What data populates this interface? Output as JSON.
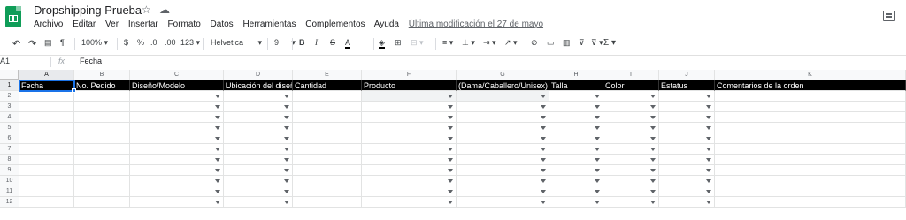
{
  "app": {
    "doc_title": "Dropshipping Prueba",
    "title_icons": [
      "star-icon",
      "cloud-icon"
    ]
  },
  "menu": {
    "items": [
      "Archivo",
      "Editar",
      "Ver",
      "Insertar",
      "Formato",
      "Datos",
      "Herramientas",
      "Complementos",
      "Ayuda"
    ],
    "last_edit": "Última modificación el 27 de mayo"
  },
  "toolbar": {
    "zoom": "100%",
    "currency": "$",
    "percent": "%",
    "dec_less": ".0",
    "dec_more": ".00",
    "format": "123",
    "font": "Helvetica",
    "font_size": "9",
    "bold": "B",
    "italic": "I",
    "strike": "S",
    "underline": "A",
    "sigma": "Σ"
  },
  "formula_bar": {
    "cell_ref": "A1",
    "fx": "fx",
    "value": "Fecha"
  },
  "sheet": {
    "columns": [
      "A",
      "B",
      "C",
      "D",
      "E",
      "F",
      "G",
      "H",
      "I",
      "J",
      "K"
    ],
    "headers": [
      "Fecha",
      "No. Pedido",
      "Diseño/Modelo",
      "Ubicación del diseño",
      "Cantidad",
      "Producto",
      "(Dama/Caballero/Unisex)",
      "Talla",
      "Color",
      "Estatus",
      "Comentarios de la orden"
    ],
    "row_numbers": [
      "1",
      "2",
      "3",
      "4",
      "5",
      "6",
      "7",
      "8",
      "9",
      "10",
      "11",
      "12"
    ],
    "dropdown_columns": [
      "C",
      "D",
      "F",
      "G",
      "H",
      "I",
      "J"
    ],
    "highlighted_cells": [
      "F2",
      "G2"
    ],
    "selected_cell": "A1"
  },
  "colors": {
    "header_bg": "#000000",
    "header_text": "#ffffff",
    "selection": "#1a73e8",
    "sheets_green": "#0f9d58"
  }
}
